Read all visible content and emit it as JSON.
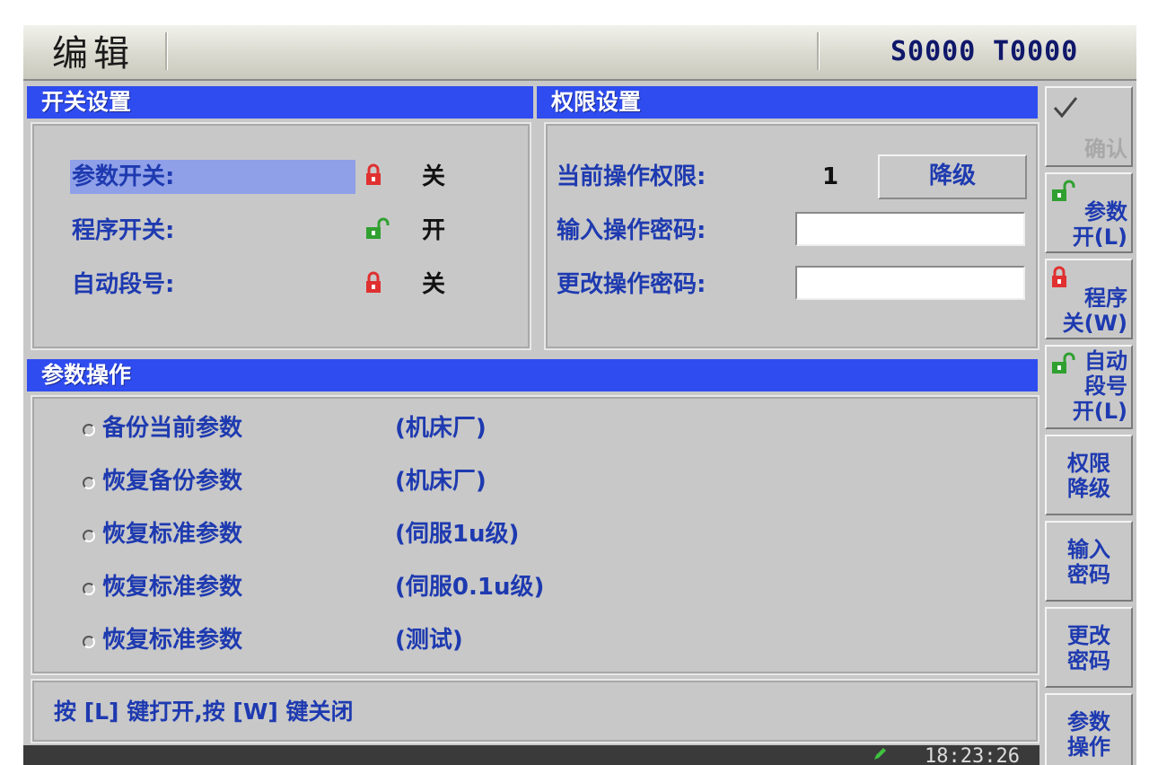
{
  "header": {
    "title": "编辑",
    "s_value": "S0000",
    "t_value": "T0000"
  },
  "switch_panel": {
    "title": "开关设置",
    "rows": [
      {
        "label": "参数开关:",
        "state": "关",
        "lock": "locked"
      },
      {
        "label": "程序开关:",
        "state": "开",
        "lock": "unlocked"
      },
      {
        "label": "自动段号:",
        "state": "关",
        "lock": "locked"
      }
    ]
  },
  "permission_panel": {
    "title": "权限设置",
    "current_label": "当前操作权限:",
    "current_value": "1",
    "downgrade_button": "降级",
    "input_label": "输入操作密码:",
    "input_value": "",
    "change_label": "更改操作密码:",
    "change_value": ""
  },
  "param_panel": {
    "title": "参数操作",
    "options": [
      {
        "label": "备份当前参数",
        "note": "(机床厂)"
      },
      {
        "label": "恢复备份参数",
        "note": "(机床厂)"
      },
      {
        "label": "恢复标准参数",
        "note": "(伺服1u级)"
      },
      {
        "label": "恢复标准参数",
        "note": "(伺服0.1u级)"
      },
      {
        "label": "恢复标准参数",
        "note": "(测试)"
      }
    ]
  },
  "status_text": "按 [L] 键打开,按 [W] 键关闭",
  "clock": "18:23:26",
  "softkeys": [
    {
      "line1": "确认",
      "line2": ""
    },
    {
      "line1": "参数",
      "line2": "开(L)"
    },
    {
      "line1": "程序",
      "line2": "关(W)"
    },
    {
      "line1": "自动",
      "line2": "段号",
      "line3": "开(L)"
    },
    {
      "line1": "权限",
      "line2": "降级"
    },
    {
      "line1": "输入",
      "line2": "密码"
    },
    {
      "line1": "更改",
      "line2": "密码"
    },
    {
      "line1": "参数",
      "line2": "操作"
    }
  ],
  "colors": {
    "title_bar": "#2f4cf0",
    "label_text": "#1e3ab0",
    "lock_red": "#e03030",
    "lock_green": "#30a030",
    "highlight": "#8fa0e8"
  }
}
